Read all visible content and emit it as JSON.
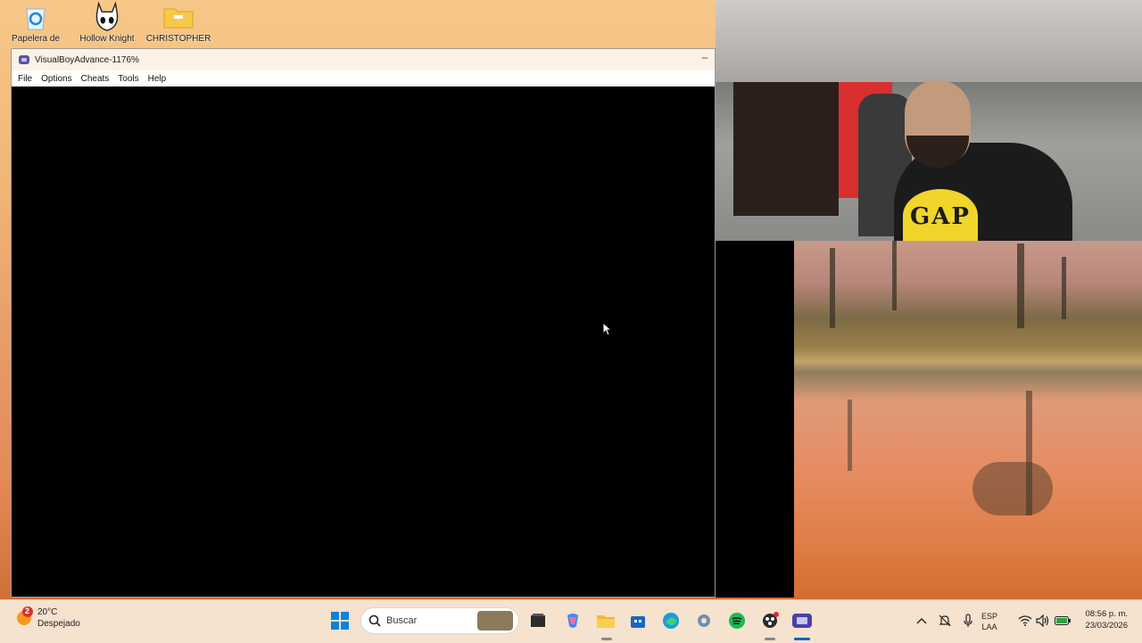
{
  "desktop": {
    "icons": [
      {
        "label": "Papelera de",
        "icon": "recycle-bin-icon"
      },
      {
        "label": "Hollow Knight",
        "icon": "hollow-knight-icon"
      },
      {
        "label": "CHRISTOPHER",
        "icon": "folder-icon"
      }
    ]
  },
  "window": {
    "title": "VisualBoyAdvance-1176%",
    "minimize": "–",
    "menu": [
      "File",
      "Options",
      "Cheats",
      "Tools",
      "Help"
    ]
  },
  "webcam": {
    "shirt_text": "GAP"
  },
  "taskbar": {
    "weather": {
      "badge": "2",
      "temp": "20°C",
      "condition": "Despejado"
    },
    "search_placeholder": "Buscar",
    "apps": [
      "start-icon",
      "search-icon",
      "file-manager-icon",
      "copilot-icon",
      "file-explorer-icon",
      "store-icon",
      "edge-icon",
      "settings-icon",
      "spotify-icon",
      "obs-icon",
      "visualboy-icon"
    ],
    "tray": {
      "lang_line1": "ESP",
      "lang_line2": "LAA",
      "time": "08:56 p. m.",
      "date": "23/03/2026"
    }
  },
  "colors": {
    "taskbar_bg": "#f5e2cf",
    "titlebar_bg": "#fbf1e5",
    "accent": "#0067c0"
  }
}
